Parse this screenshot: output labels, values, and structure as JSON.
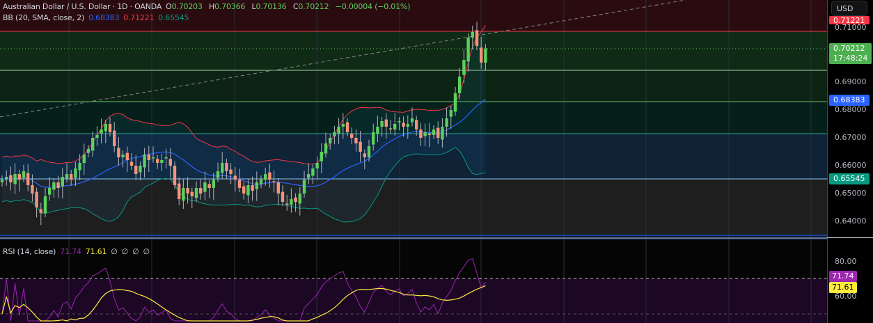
{
  "header": {
    "symbol": "Australian Dollar / U.S. Dollar · 1D · OANDA",
    "open_label": "O",
    "open": "0.70203",
    "high_label": "H",
    "high": "0.70366",
    "low_label": "L",
    "low": "0.70136",
    "close_label": "C",
    "close": "0.70212",
    "change": "−0.00004 (−0.01%)"
  },
  "bb": {
    "label": "BB (20, SMA, close, 2)",
    "basis": "0.68383",
    "upper": "0.71221",
    "lower": "0.65545"
  },
  "rsi": {
    "label": "RSI (14, close)",
    "value": "71.74",
    "ma": "71.61",
    "extras": [
      "∅",
      "∅",
      "∅",
      "∅"
    ]
  },
  "axis": {
    "currency": "USD",
    "price_ticks": [
      "0.71000",
      "0.69000",
      "0.68000",
      "0.67000",
      "0.66000",
      "0.65000",
      "0.64000"
    ],
    "rsi_ticks": [
      "80.00",
      "60.00"
    ],
    "tags": {
      "upper": "0.71221",
      "last": "0.70212",
      "countdown": "17:48:24",
      "basis": "0.68383",
      "lower": "0.65545",
      "rsi": "71.74",
      "rsi_ma": "71.61"
    }
  },
  "colors": {
    "up": "#5ccf5c",
    "down": "#f5937a",
    "bb_basis": "#2962ff",
    "bb_upper": "#f23645",
    "bb_lower": "#089981",
    "rsi": "#9c27b0",
    "rsi_ma": "#ffeb3b"
  },
  "chart_data": {
    "type": "candlestick",
    "price_range": [
      0.635,
      0.72
    ],
    "closes": [
      0.655,
      0.656,
      0.654,
      0.657,
      0.655,
      0.658,
      0.653,
      0.65,
      0.645,
      0.643,
      0.649,
      0.652,
      0.654,
      0.652,
      0.656,
      0.657,
      0.655,
      0.659,
      0.661,
      0.664,
      0.666,
      0.67,
      0.671,
      0.673,
      0.675,
      0.672,
      0.667,
      0.663,
      0.664,
      0.662,
      0.66,
      0.657,
      0.66,
      0.664,
      0.662,
      0.663,
      0.661,
      0.662,
      0.663,
      0.66,
      0.653,
      0.648,
      0.652,
      0.65,
      0.649,
      0.652,
      0.65,
      0.654,
      0.652,
      0.655,
      0.658,
      0.661,
      0.658,
      0.657,
      0.655,
      0.652,
      0.65,
      0.653,
      0.651,
      0.654,
      0.655,
      0.657,
      0.655,
      0.654,
      0.65,
      0.647,
      0.646,
      0.648,
      0.647,
      0.65,
      0.655,
      0.657,
      0.659,
      0.661,
      0.665,
      0.668,
      0.67,
      0.672,
      0.674,
      0.675,
      0.672,
      0.67,
      0.668,
      0.665,
      0.663,
      0.667,
      0.672,
      0.674,
      0.676,
      0.674,
      0.673,
      0.675,
      0.676,
      0.674,
      0.675,
      0.677,
      0.673,
      0.67,
      0.672,
      0.671,
      0.673,
      0.67,
      0.674,
      0.677,
      0.68,
      0.686,
      0.692,
      0.698,
      0.706,
      0.708,
      0.703,
      0.697,
      0.70212
    ]
  }
}
